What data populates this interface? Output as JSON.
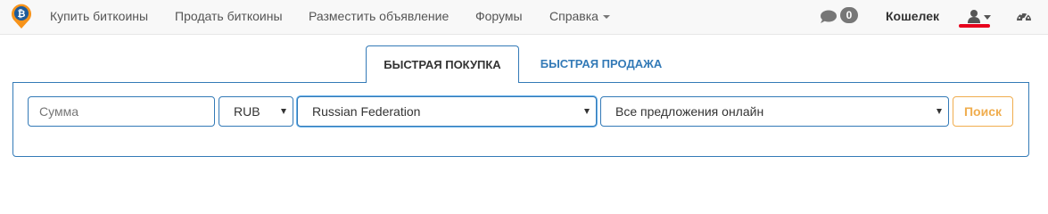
{
  "nav": {
    "items": [
      {
        "label": "Купить биткоины"
      },
      {
        "label": "Продать биткоины"
      },
      {
        "label": "Разместить объявление"
      },
      {
        "label": "Форумы"
      },
      {
        "label": "Справка"
      }
    ],
    "messages_count": "0",
    "wallet_label": "Кошелек"
  },
  "tabs": {
    "quick_buy": "БЫСТРАЯ ПОКУПКА",
    "quick_sell": "БЫСТРАЯ ПРОДАЖА"
  },
  "search": {
    "amount_placeholder": "Сумма",
    "currency": "RUB",
    "country": "Russian Federation",
    "offer_type": "Все предложения онлайн",
    "button_label": "Поиск"
  },
  "colors": {
    "accent": "#337ab7",
    "search_button": "#f0ad4e",
    "annotation_underline": "#e8001c",
    "logo": "#f7931a"
  },
  "icons": [
    "bitcoin-logo-icon",
    "chat-bubble-icon",
    "user-icon",
    "dashboard-icon",
    "caret-down-icon"
  ]
}
